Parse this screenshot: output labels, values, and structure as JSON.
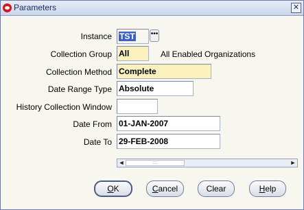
{
  "window": {
    "title": "Parameters",
    "close_glyph": "✕"
  },
  "form": {
    "instance": {
      "label": "Instance",
      "value": "TST"
    },
    "lov_glyph": "•••",
    "collection_group": {
      "label": "Collection Group",
      "value": "All",
      "description": "All Enabled Organizations"
    },
    "collection_method": {
      "label": "Collection Method",
      "value": "Complete"
    },
    "date_range_type": {
      "label": "Date Range Type",
      "value": "Absolute"
    },
    "history_window": {
      "label": "History Collection Window",
      "value": ""
    },
    "date_from": {
      "label": "Date From",
      "value": "01-JAN-2007"
    },
    "date_to": {
      "label": "Date To",
      "value": "29-FEB-2008"
    }
  },
  "scrollbar": {
    "left_glyph": "◄",
    "right_glyph": "►",
    "grip": "::::"
  },
  "buttons": {
    "ok": {
      "accel": "O",
      "rest": "K"
    },
    "cancel": {
      "accel": "C",
      "rest": "ancel"
    },
    "clear": {
      "label": "Clear"
    },
    "help": {
      "accel": "H",
      "rest": "elp"
    }
  },
  "colors": {
    "required_field": "#fbf1bf",
    "selection": "#3e61c5",
    "title_text": "#1b2a55"
  }
}
